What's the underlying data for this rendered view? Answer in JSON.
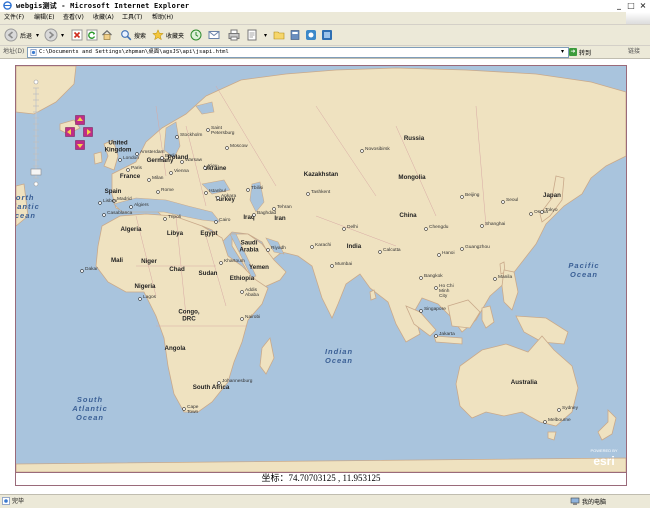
{
  "window": {
    "title": "webgis测试 - Microsoft Internet Explorer",
    "controls": [
      "_",
      "□",
      "×"
    ]
  },
  "menubar": {
    "items": [
      "文件(F)",
      "编辑(E)",
      "查看(V)",
      "收藏(A)",
      "工具(T)",
      "帮助(H)"
    ]
  },
  "toolbar": {
    "back_label": "后退",
    "search_label": "搜索",
    "favorites_label": "收藏夹"
  },
  "addressbar": {
    "label": "地址(D)",
    "url": "C:\\Documents and Settings\\zhpman\\桌面\\agsJS\\api\\jsapi.html",
    "go_label": "转到",
    "links_label": "链接"
  },
  "map": {
    "zoom_levels": 16,
    "zoom_selected_level": 14,
    "pan_controls": [
      "pan-up",
      "pan-left",
      "pan-right",
      "pan-down"
    ],
    "attribution": {
      "small": "POWERED BY",
      "brand": "esri"
    },
    "colors": {
      "land": "#efe2c0",
      "ocean": "#a9c4dd",
      "border": "#9a6a7a"
    },
    "oceans": [
      {
        "lines": [
          "North",
          "Atlantic",
          "Ocean"
        ]
      },
      {
        "lines": [
          "Pacific",
          "Ocean"
        ]
      },
      {
        "lines": [
          "Indian",
          "Ocean"
        ]
      },
      {
        "lines": [
          "South",
          "Atlantic",
          "Ocean"
        ]
      }
    ],
    "countries": [
      "Russia",
      "Kazakhstan",
      "Mongolia",
      "China",
      "India",
      "Iran",
      "Iraq",
      "Turkey",
      "Spain",
      "France",
      "Germany",
      "Poland",
      "Ukraine",
      "Algeria",
      "Libya",
      "Egypt",
      "Mali",
      "Niger",
      "Chad",
      "Sudan",
      "Nigeria",
      "Ethiopia",
      "Yemen",
      "Saudi Arabia",
      "Congo, DRC",
      "Angola",
      "South Africa",
      "Australia",
      "Japan",
      "United Kingdom"
    ],
    "country_display": {
      "Saudi Arabia": [
        "Saudi",
        "Arabia"
      ],
      "Congo, DRC": [
        "Congo,",
        "DRC"
      ],
      "United Kingdom": [
        "United",
        "Kingdom"
      ]
    },
    "cities": [
      "Saint Petersburg",
      "Stockholm",
      "Moscow",
      "Novosibirsk",
      "Kiev",
      "Warsaw",
      "Berlin",
      "Amsterdam",
      "London",
      "Paris",
      "Madrid",
      "Lisbon",
      "Casablanca",
      "Algiers",
      "Rome",
      "Milan",
      "Vienna",
      "Istanbul",
      "Ankara",
      "Tbilisi",
      "Baghdad",
      "Tehran",
      "Riyadh",
      "Cairo",
      "Tripoli",
      "Dakar",
      "Lagos",
      "Addis Ababa",
      "Nairobi",
      "Khartoum",
      "Karachi",
      "Delhi",
      "Mumbai",
      "Calcutta",
      "Tashkent",
      "Beijing",
      "Shanghai",
      "Chengdu",
      "Guangzhou",
      "Hanoi",
      "Bangkok",
      "Ho Chi Minh City",
      "Singapore",
      "Jakarta",
      "Manila",
      "Seoul",
      "Osaka",
      "Tokyo",
      "Johannesburg",
      "Cape Town",
      "Sydney",
      "Melbourne"
    ],
    "city_display": {
      "Saint Petersburg": [
        "Saint",
        "Petersburg"
      ],
      "Ho Chi Minh City": [
        "Ho Chi",
        "Minh",
        "City"
      ],
      "Addis Ababa": [
        "Addis",
        "Ababa"
      ],
      "Cape Town": [
        "Cape",
        "Town"
      ]
    }
  },
  "coordinates": {
    "text": "坐标：74.70703125 , 11.953125"
  },
  "statusbar": {
    "left": "完毕",
    "zone": "我的电脑"
  }
}
